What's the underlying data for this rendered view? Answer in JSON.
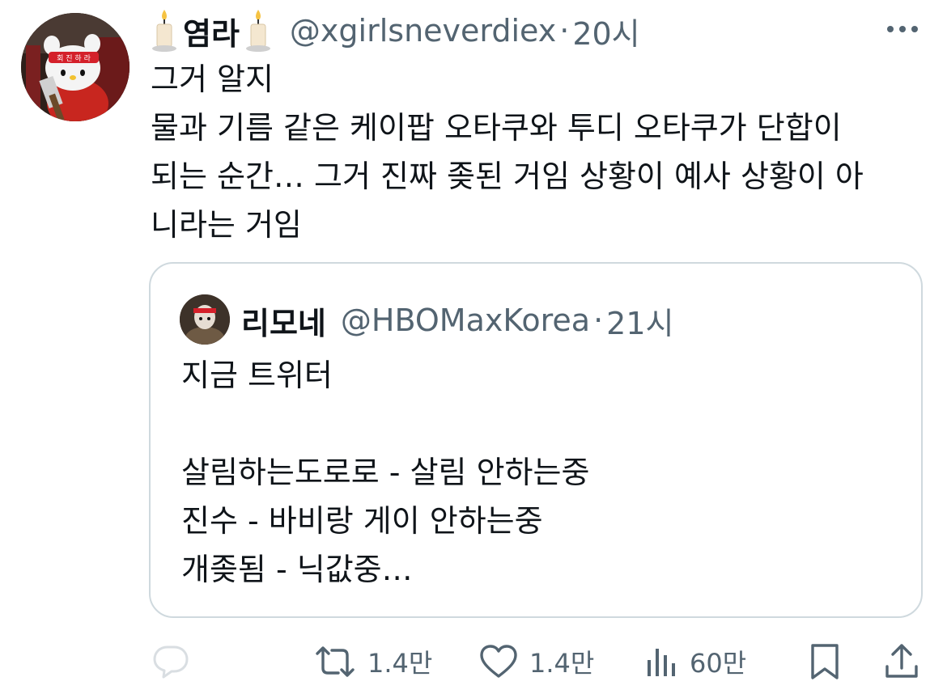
{
  "tweet": {
    "name": "염라",
    "name_emoji_left": "candle-icon",
    "name_emoji_right": "candle-icon",
    "handle": "@xgirlsneverdiex",
    "separator": "·",
    "time": "20시",
    "lines": [
      "그거 알지",
      "물과 기름 같은 케이팝 오타쿠와 투디 오타쿠가 단합이",
      "되는 순간… 그거 진짜 좆된 거임 상황이 예사 상황이 아",
      "니라는 거임"
    ]
  },
  "quote": {
    "name": "리모네",
    "handle": "@HBOMaxKorea",
    "separator": "·",
    "time": "21시",
    "lines": [
      "지금 트위터",
      "",
      "살림하는도로로 - 살림 안하는중",
      "진수 - 바비랑 게이 안하는중",
      "개좆됨 - 닉값중…"
    ]
  },
  "actions": {
    "reply": {
      "icon": "reply-icon",
      "count": ""
    },
    "retweet": {
      "icon": "retweet-icon",
      "count": "1.4만"
    },
    "like": {
      "icon": "heart-icon",
      "count": "1.4만"
    },
    "views": {
      "icon": "views-icon",
      "count": "60만"
    },
    "bookmark": {
      "icon": "bookmark-icon"
    },
    "share": {
      "icon": "share-icon"
    }
  },
  "colors": {
    "text": "#0f1419",
    "secondary": "#536471",
    "border": "#cfd9de",
    "avatar_headband": "#d4202a"
  }
}
